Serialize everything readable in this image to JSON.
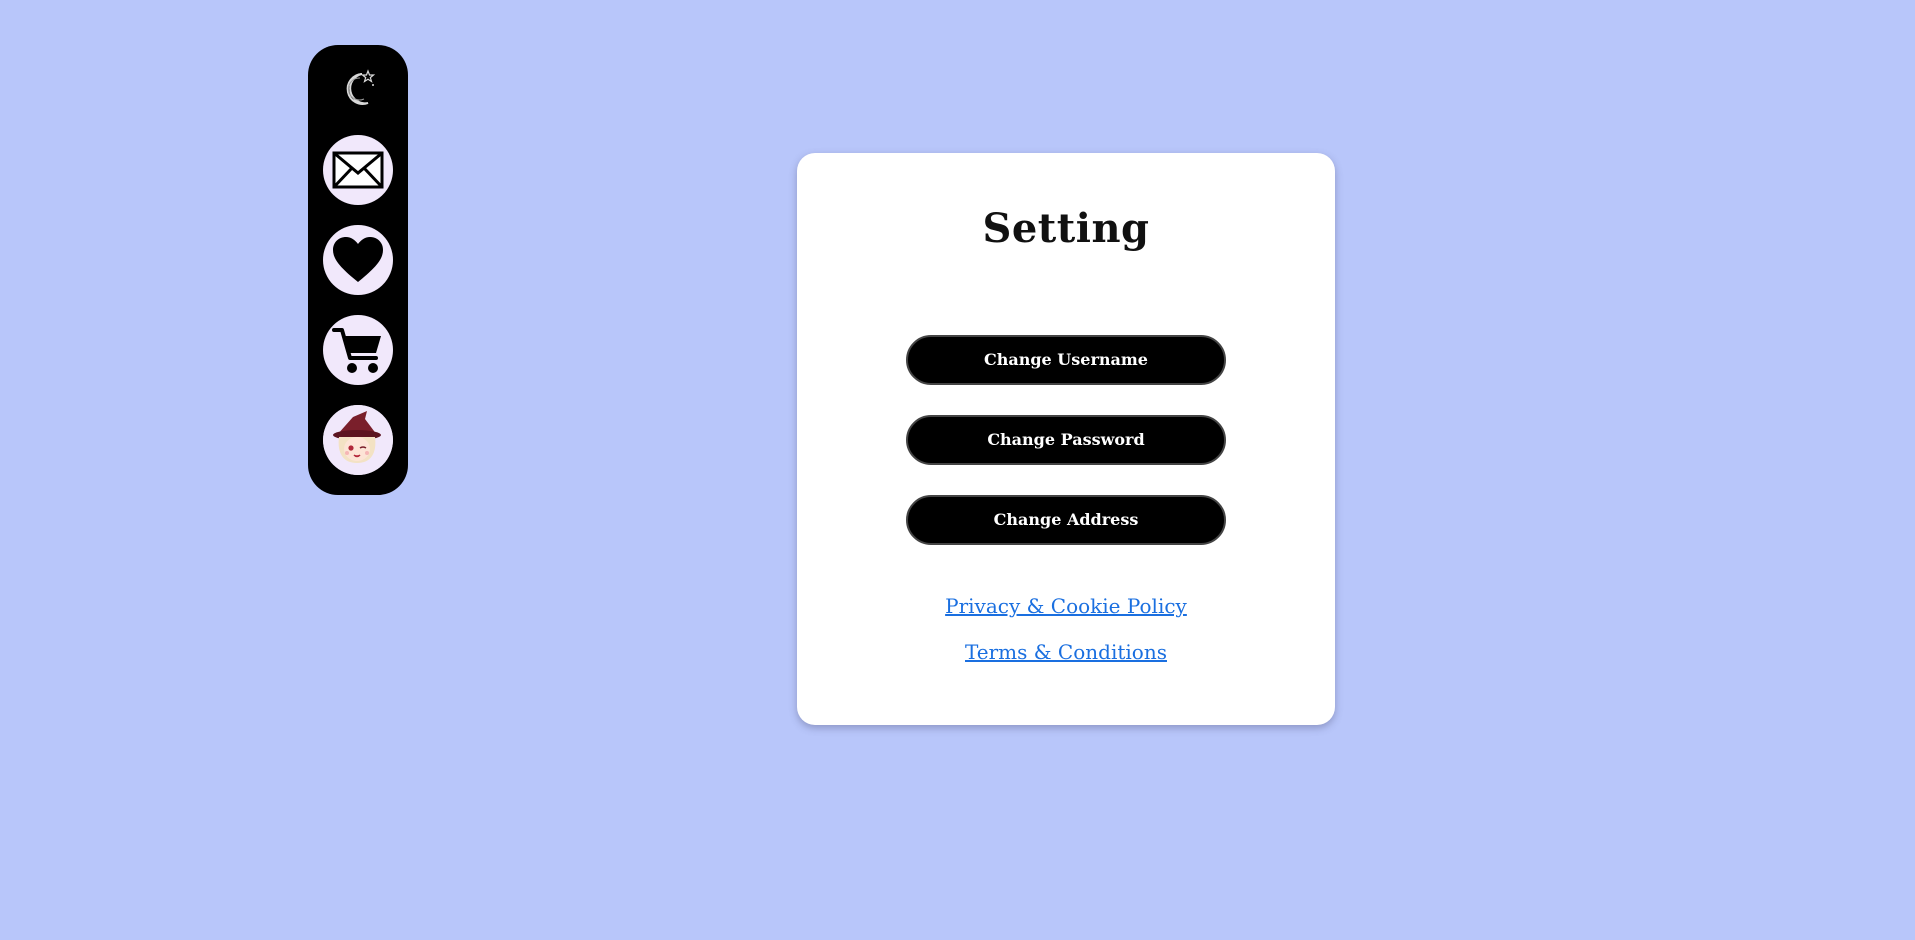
{
  "colors": {
    "background": "#b8c6fa",
    "sidebar": "#000000",
    "nav_button": "#f1e8fb",
    "card": "#ffffff",
    "button": "#000000",
    "button_text": "#ffffff",
    "link": "#1a6fe0"
  },
  "sidebar": {
    "logo_icon": "moon-star-icon",
    "items": [
      {
        "name": "messages",
        "icon": "mail-icon"
      },
      {
        "name": "favorites",
        "icon": "heart-icon"
      },
      {
        "name": "cart",
        "icon": "cart-icon"
      },
      {
        "name": "profile",
        "icon": "avatar"
      }
    ]
  },
  "settings": {
    "title": "Setting",
    "buttons": {
      "change_username": "Change Username",
      "change_password": "Change Password",
      "change_address": "Change Address"
    },
    "links": {
      "privacy": "Privacy & Cookie Policy",
      "terms": "Terms & Conditions"
    }
  }
}
